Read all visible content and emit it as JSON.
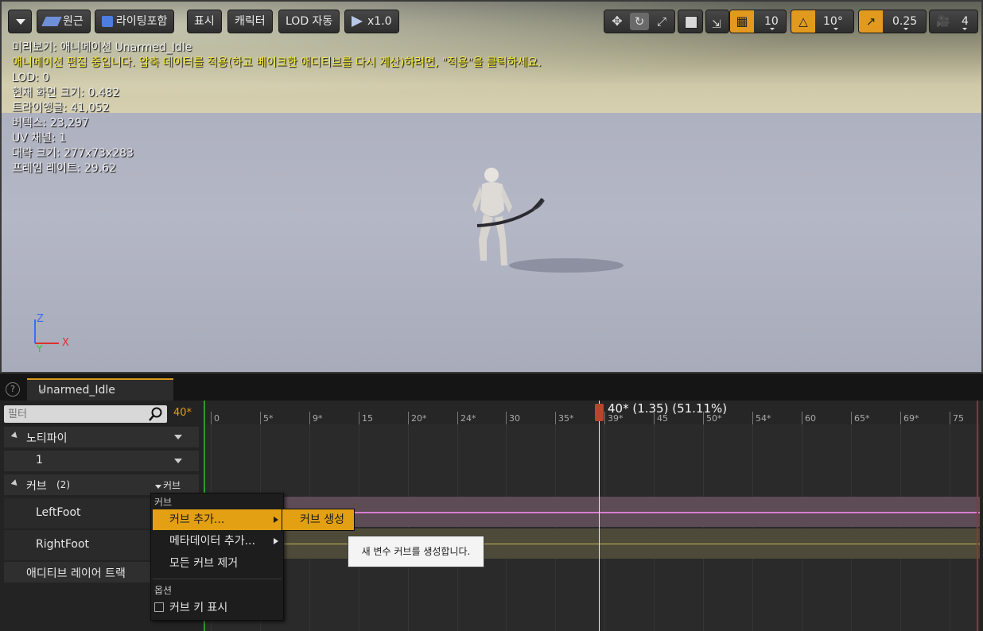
{
  "toolbar": {
    "menu_label": "",
    "perspective_label": "원근",
    "lighting_label": "라이팅포함",
    "show_label": "표시",
    "character_label": "캐릭터",
    "lod_label": "LOD 자동",
    "speed_label": "x1.0",
    "grid_snap_value": "10",
    "rotation_snap_value": "10°",
    "scale_snap_value": "0.25",
    "camera_speed_value": "4"
  },
  "overlay": {
    "preview": "미리보기: 애니메이션 Unarmed_Idle",
    "warning": "애니메이션 편집 중입니다. 압축 데이터를 적용(하고 베이크한 애디티브를 다시 계산)하려면, \"적용\"을 클릭하세요.",
    "lod": "LOD: 0",
    "screen_size": "현재 화면 크기: 0.482",
    "triangles": "트라이앵글: 41,052",
    "vertices": "버텍스: 23,297",
    "uv_channels": "UV 채널: 1",
    "approx_size": "대략 크기: 277x73x283",
    "frame_rate": "프레임 레이트: 29.62"
  },
  "axis": {
    "z": "Z",
    "y": "Y",
    "x": "X"
  },
  "tab": {
    "title": "Unarmed_Idle",
    "help": "?"
  },
  "filter": {
    "placeholder": "필터",
    "frame": "40*"
  },
  "tracks": {
    "notify_label": "노티파이",
    "notify_value": "1",
    "curves_label": "커브",
    "curves_count": "(2)",
    "curves_button": "커브",
    "left_foot": "LeftFoot",
    "right_foot": "RightFoot",
    "additive_label": "애디티브 레이어 트랙"
  },
  "ruler": {
    "labels": [
      "0",
      "5*",
      "9*",
      "15",
      "20*",
      "24*",
      "30",
      "35*",
      "39*",
      "45",
      "50*",
      "54*",
      "60",
      "65*",
      "69*",
      "75"
    ],
    "playhead": "40* (1.35) (51.11%)"
  },
  "context_menu": {
    "header_curve": "커브",
    "add_curve": "커브 추가...",
    "add_metadata": "메타데이터 추가...",
    "remove_all": "모든 커브 제거",
    "header_options": "옵션",
    "show_keys": "커브 키 표시"
  },
  "submenu": {
    "create_curve": "커브 생성"
  },
  "tooltip": {
    "text": "새 변수 커브를 생성합니다."
  },
  "colors": {
    "accent": "#e3a013",
    "curve_left_foot": "#d77bd1",
    "curve_right_foot": "#c8b45a",
    "playhead": "#b9452f"
  }
}
